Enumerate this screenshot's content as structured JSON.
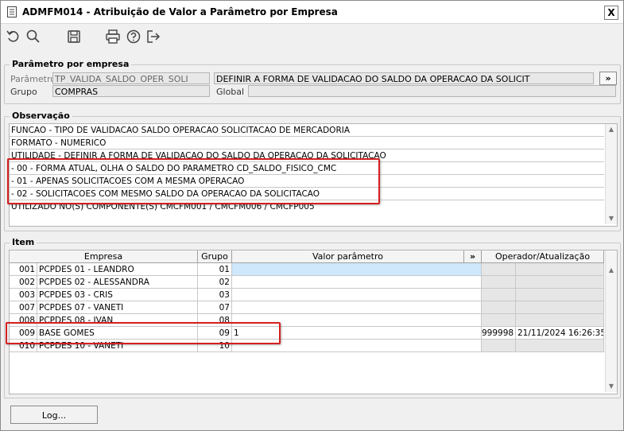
{
  "window": {
    "title": "ADMFM014 - Atribuição de Valor a Parâmetro por Empresa",
    "close": "X"
  },
  "toolbar": {
    "icons": [
      "undo-icon",
      "search-icon",
      "save-icon",
      "print-icon",
      "help-icon",
      "exit-icon"
    ]
  },
  "param_group": {
    "legend": "Parâmetro por empresa",
    "parametro_label": "Parâmetro",
    "parametro_value": "TP_VALIDA_SALDO_OPER_SOLI",
    "descricao_value": "DEFINIR A FORMA DE VALIDACAO DO SALDO DA OPERACAO DA SOLICIT",
    "more_button": "»",
    "grupo_label": "Grupo",
    "grupo_value": "COMPRAS",
    "global_label": "Global",
    "global_value": ""
  },
  "observacao": {
    "legend": "Observação",
    "lines": [
      "FUNCAO - TIPO DE VALIDACAO SALDO OPERACAO SOLICITACAO DE MERCADORIA",
      "FORMATO - NUMERICO",
      "UTILIDADE - DEFINIR A FORMA DE VALIDACAO DO SALDO DA OPERACAO DA SOLICITACAO",
      " - 00 - FORMA ATUAL, OLHA O SALDO DO PARAMETRO CD_SALDO_FISICO_CMC",
      " - 01 - APENAS SOLICITACOES COM A MESMA OPERACAO",
      " - 02 - SOLICITACOES COM MESMO SALDO DA OPERACAO DA SOLICITACAO",
      "UTILIZADO NO(S) COMPONENTE(S) CMCFM001 / CMCFM006 / CMCFP005"
    ]
  },
  "item": {
    "legend": "Item",
    "headers": {
      "empresa": "Empresa",
      "grupo": "Grupo",
      "valor": "Valor parâmetro",
      "more": "»",
      "operador": "Operador/Atualização"
    },
    "rows": [
      {
        "cod": "001",
        "nome": "PCPDES 01 - LEANDRO",
        "grupo": "01",
        "valor": "",
        "operador": "",
        "data": ""
      },
      {
        "cod": "002",
        "nome": "PCPDES 02 - ALESSANDRA",
        "grupo": "02",
        "valor": "",
        "operador": "",
        "data": ""
      },
      {
        "cod": "003",
        "nome": "PCPDES 03 - CRIS",
        "grupo": "03",
        "valor": "",
        "operador": "",
        "data": ""
      },
      {
        "cod": "007",
        "nome": "PCPDES 07 - VANETI",
        "grupo": "07",
        "valor": "",
        "operador": "",
        "data": ""
      },
      {
        "cod": "008",
        "nome": "PCPDES 08 - IVAN",
        "grupo": "08",
        "valor": "",
        "operador": "",
        "data": ""
      },
      {
        "cod": "009",
        "nome": "BASE GOMES",
        "grupo": "09",
        "valor": "1",
        "operador": "999998",
        "data": "21/11/2024 16:26:35"
      },
      {
        "cod": "010",
        "nome": "PCPDES 10 - VANETI",
        "grupo": "10",
        "valor": "",
        "operador": "",
        "data": ""
      }
    ]
  },
  "log_button": "Log..."
}
